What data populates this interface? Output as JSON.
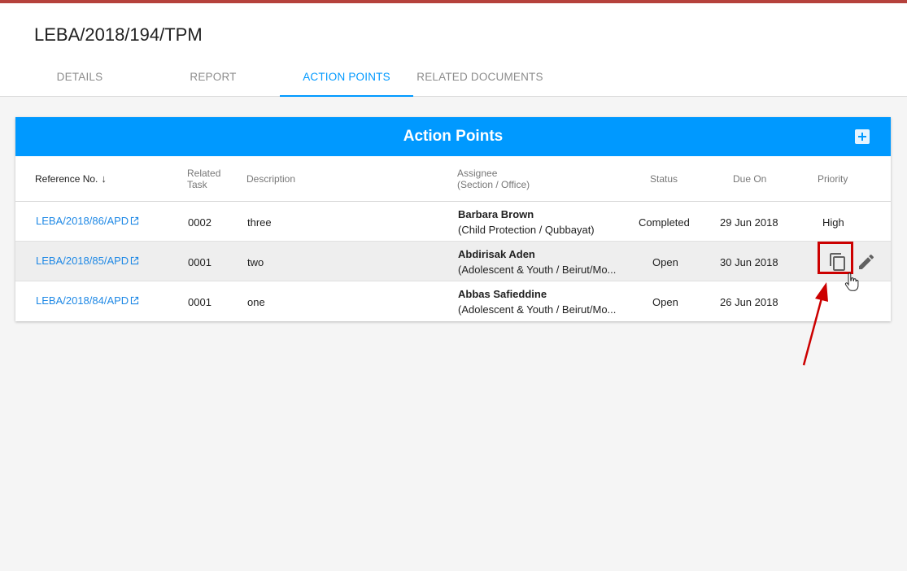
{
  "page": {
    "title": "LEBA/2018/194/TPM"
  },
  "tabs": [
    {
      "label": "DETAILS"
    },
    {
      "label": "REPORT"
    },
    {
      "label": "ACTION POINTS"
    },
    {
      "label": "RELATED DOCUMENTS"
    }
  ],
  "card": {
    "title": "Action Points"
  },
  "columns": {
    "reference": "Reference No.",
    "related_task_1": "Related",
    "related_task_2": "Task",
    "description": "Description",
    "assignee_1": "Assignee",
    "assignee_2": "(Section / Office)",
    "status": "Status",
    "due_on": "Due On",
    "priority": "Priority"
  },
  "rows": [
    {
      "reference": "LEBA/2018/86/APD",
      "task": "0002",
      "description": "three",
      "assignee": "Barbara Brown",
      "office": "(Child Protection / Qubbayat)",
      "status": "Completed",
      "due": "29 Jun 2018",
      "priority": "High"
    },
    {
      "reference": "LEBA/2018/85/APD",
      "task": "0001",
      "description": "two",
      "assignee": "Abdirisak Aden",
      "office": "(Adolescent & Youth / Beirut/Mo...",
      "status": "Open",
      "due": "30 Jun 2018",
      "priority": ""
    },
    {
      "reference": "LEBA/2018/84/APD",
      "task": "0001",
      "description": "one",
      "assignee": "Abbas Safieddine",
      "office": "(Adolescent & Youth / Beirut/Mo...",
      "status": "Open",
      "due": "26 Jun 2018",
      "priority": ""
    }
  ],
  "colors": {
    "accent": "#0099ff",
    "link": "#1e88e5",
    "annotation": "#cc0000",
    "top_stripe": "#b5413c"
  },
  "icons": {
    "add": "plus-box-icon",
    "sort": "arrow-down-icon",
    "external": "open-in-new-icon",
    "copy": "content-copy-icon",
    "edit": "pencil-icon",
    "cursor": "hand-pointer-icon"
  }
}
